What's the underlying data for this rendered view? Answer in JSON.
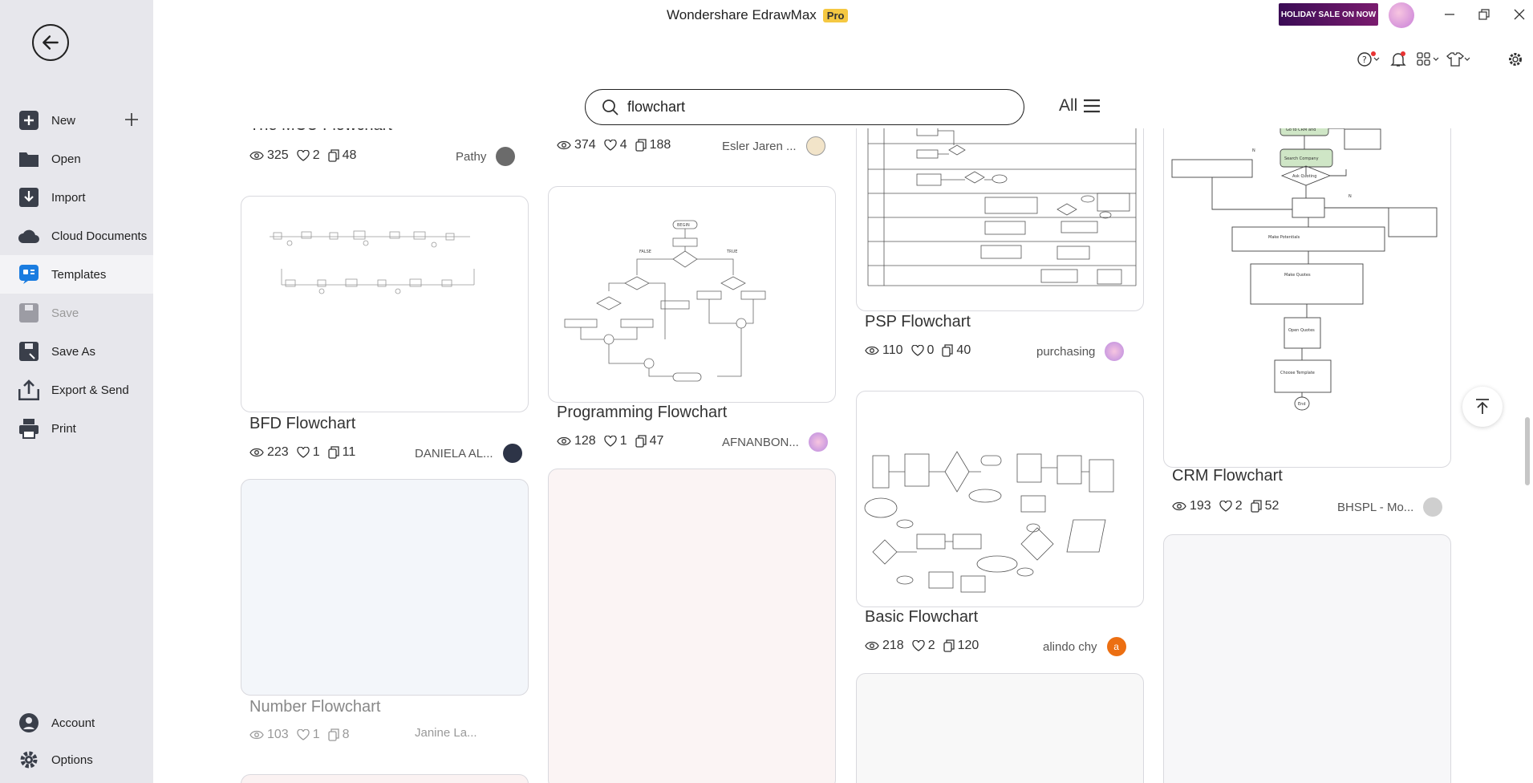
{
  "app": {
    "title": "Wondershare EdrawMax",
    "badge": "Pro",
    "holiday": "HOLIDAY SALE ON NOW"
  },
  "sidebar": {
    "items": [
      {
        "label": "New"
      },
      {
        "label": "Open"
      },
      {
        "label": "Import"
      },
      {
        "label": "Cloud Documents"
      },
      {
        "label": "Templates"
      },
      {
        "label": "Save"
      },
      {
        "label": "Save As"
      },
      {
        "label": "Export & Send"
      },
      {
        "label": "Print"
      }
    ],
    "bottom": [
      {
        "label": "Account"
      },
      {
        "label": "Options"
      }
    ]
  },
  "search": {
    "value": "flowchart"
  },
  "filter": {
    "label": "All"
  },
  "cards": [
    {
      "title": "The MCU Flowchart",
      "views": "325",
      "likes": "2",
      "copies": "48",
      "author": "Pathy"
    },
    {
      "title": "",
      "views": "374",
      "likes": "4",
      "copies": "188",
      "author": "Esler Jaren ..."
    },
    {
      "title": "BFD Flowchart",
      "views": "223",
      "likes": "1",
      "copies": "11",
      "author": "DANIELA AL..."
    },
    {
      "title": "Programming Flowchart",
      "views": "128",
      "likes": "1",
      "copies": "47",
      "author": "AFNANBON..."
    },
    {
      "title": "PSP Flowchart",
      "views": "110",
      "likes": "0",
      "copies": "40",
      "author": "purchasing"
    },
    {
      "title": "CRM Flowchart",
      "views": "193",
      "likes": "2",
      "copies": "52",
      "author": "BHSPL - Mo..."
    },
    {
      "title": "Basic Flowchart",
      "views": "218",
      "likes": "2",
      "copies": "120",
      "author": "alindo chy",
      "author_initial": "a"
    },
    {
      "title": "Number Flowchart",
      "views": "103",
      "likes": "1",
      "copies": "8",
      "author": "Janine La..."
    }
  ],
  "colors": {
    "accent": "#1a7ce0",
    "sidebar_bg": "#e7e7ec",
    "basic_avatar": "#ec6f12"
  }
}
